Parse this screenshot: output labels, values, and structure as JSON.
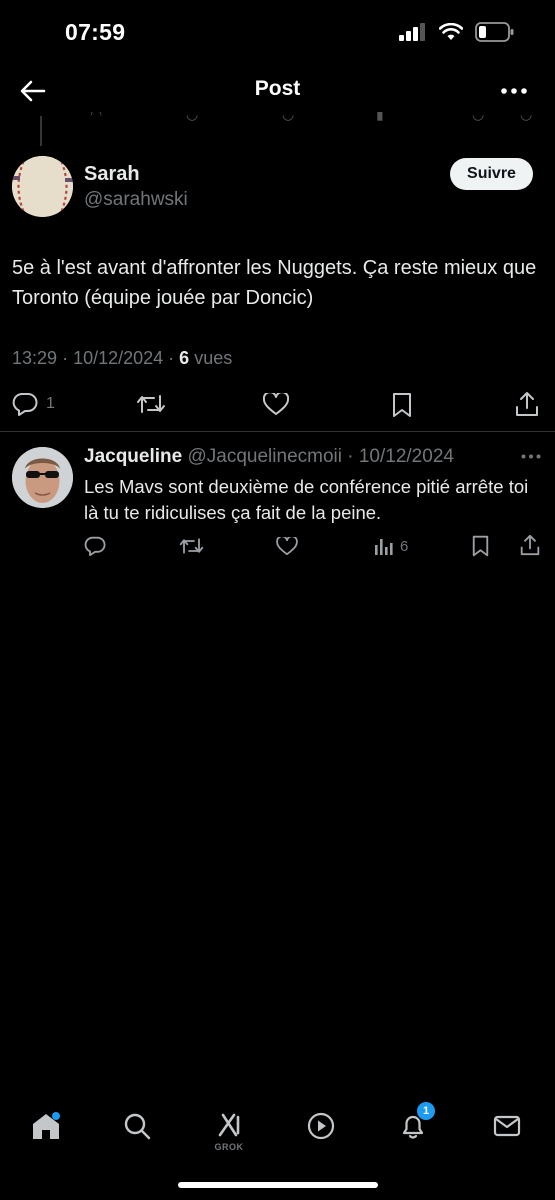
{
  "status_bar": {
    "time": "07:59"
  },
  "header": {
    "title": "Post"
  },
  "post": {
    "author_name": "Sarah",
    "author_handle": "@sarahwski",
    "follow_label": "Suivre",
    "text": "5e à l'est avant d'affronter les Nuggets. Ça reste mieux que Toronto (équipe jouée par Doncic)",
    "time": "13:29",
    "date": "10/12/2024",
    "views_count": "6",
    "views_label": "vues",
    "reply_count": "1"
  },
  "reply": {
    "author_name": "Jacqueline",
    "author_handle": "@Jacquelinecmoii",
    "date": "10/12/2024",
    "text": "Les Mavs sont deuxième de conférence pitié arrête toi là tu te ridiculises ça fait de la peine.",
    "views_count": "6"
  },
  "bottom_nav": {
    "grok_label": "GROK",
    "notifications_badge": "1"
  },
  "colors": {
    "background": "#000000",
    "text": "#e7e9ea",
    "muted": "#71767b",
    "accent": "#1d9bf0",
    "follow_bg": "#eff3f4"
  }
}
